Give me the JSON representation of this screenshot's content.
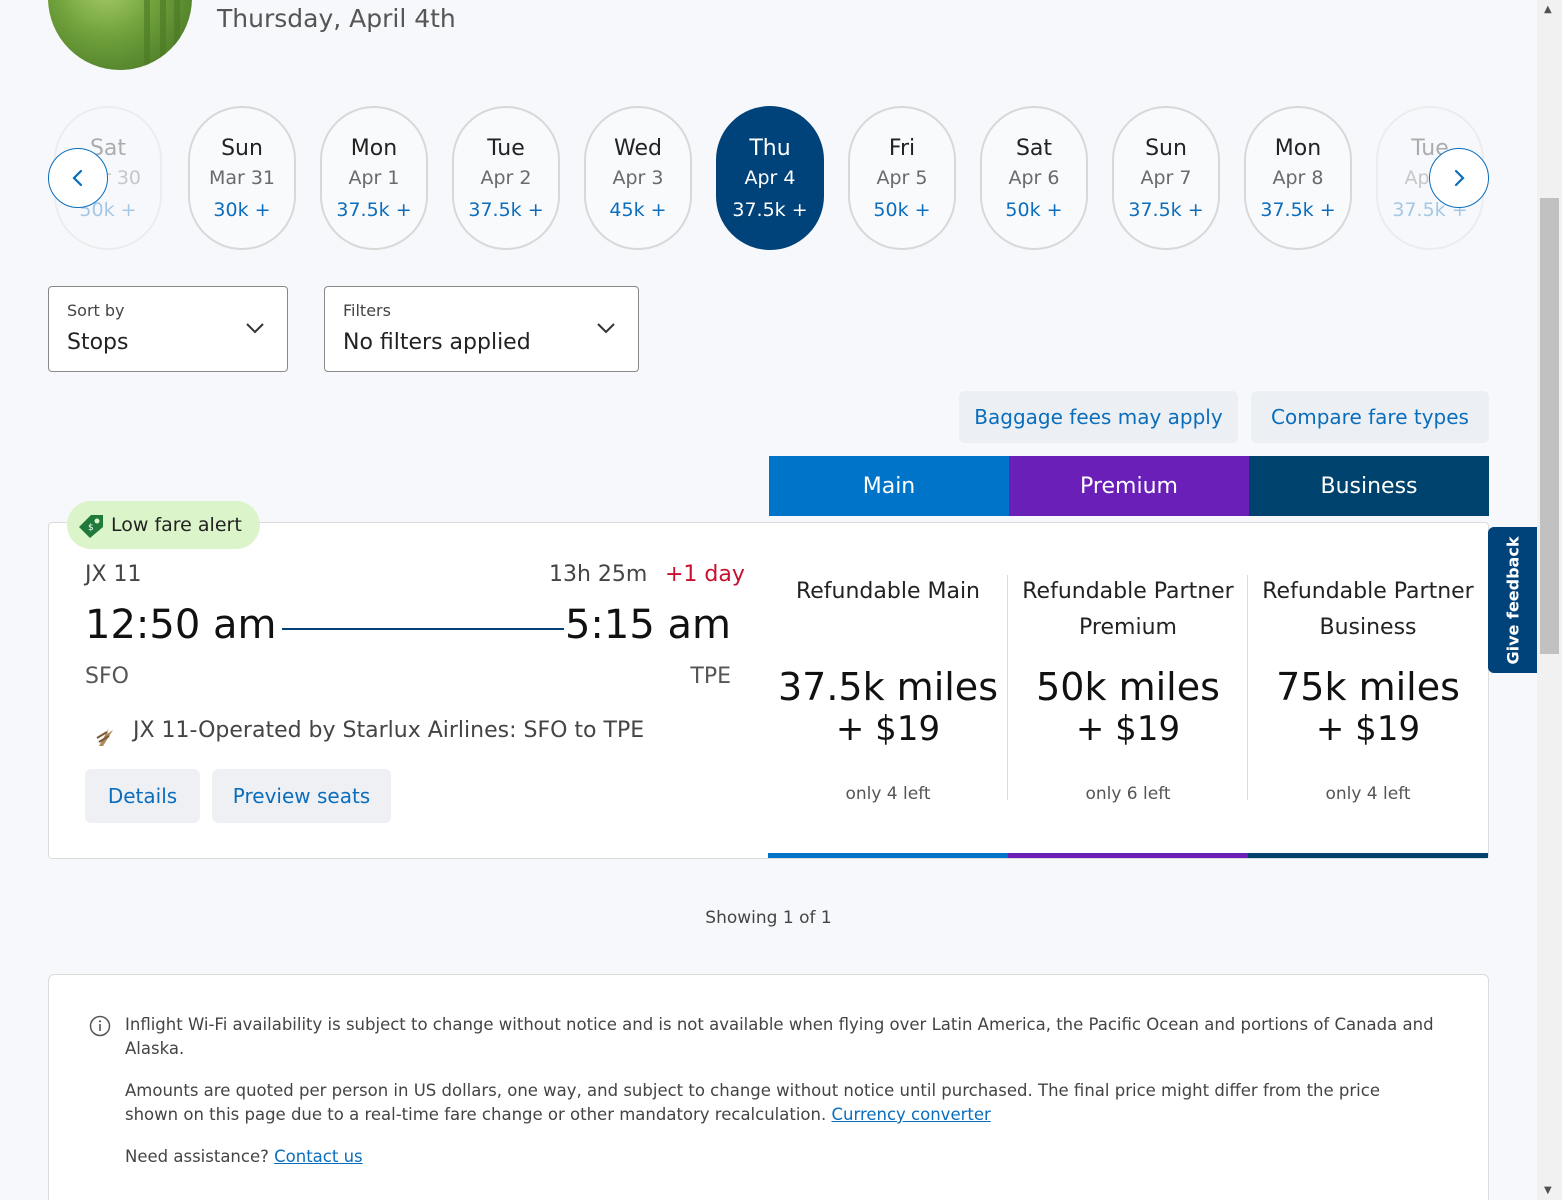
{
  "header": {
    "date": "Thursday, April 4th"
  },
  "date_strip": [
    {
      "dow": "Sat",
      "md": "Mar 30",
      "price": "50k +",
      "state": "faded"
    },
    {
      "dow": "Sun",
      "md": "Mar 31",
      "price": "30k +",
      "state": "normal"
    },
    {
      "dow": "Mon",
      "md": "Apr 1",
      "price": "37.5k +",
      "state": "normal"
    },
    {
      "dow": "Tue",
      "md": "Apr 2",
      "price": "37.5k +",
      "state": "normal"
    },
    {
      "dow": "Wed",
      "md": "Apr 3",
      "price": "45k +",
      "state": "normal"
    },
    {
      "dow": "Thu",
      "md": "Apr 4",
      "price": "37.5k +",
      "state": "selected"
    },
    {
      "dow": "Fri",
      "md": "Apr 5",
      "price": "50k +",
      "state": "normal"
    },
    {
      "dow": "Sat",
      "md": "Apr 6",
      "price": "50k +",
      "state": "normal"
    },
    {
      "dow": "Sun",
      "md": "Apr 7",
      "price": "37.5k +",
      "state": "normal"
    },
    {
      "dow": "Mon",
      "md": "Apr 8",
      "price": "37.5k +",
      "state": "normal"
    },
    {
      "dow": "Tue",
      "md": "Apr 9",
      "price": "37.5k +",
      "state": "faded"
    }
  ],
  "sort": {
    "label": "Sort by",
    "value": "Stops"
  },
  "filters": {
    "label": "Filters",
    "value": "No filters applied"
  },
  "links": {
    "baggage": "Baggage fees may apply",
    "compare": "Compare fare types"
  },
  "fare_tabs": [
    {
      "label": "Main",
      "color": "#0074c8"
    },
    {
      "label": "Premium",
      "color": "#6a1fb8"
    },
    {
      "label": "Business",
      "color": "#00426e"
    }
  ],
  "flight": {
    "badge": "Low fare alert",
    "number": "JX 11",
    "duration": "13h 25m",
    "plus_day": "+1 day",
    "depart_time": "12:50 am",
    "arrive_time": "5:15 am",
    "depart_airport": "SFO",
    "arrive_airport": "TPE",
    "operated_by": "JX 11-Operated by Starlux Airlines: SFO to TPE",
    "details_btn": "Details",
    "preview_btn": "Preview seats"
  },
  "fares": [
    {
      "name": "Refundable Main",
      "miles": "37.5k miles",
      "tax": "+ $19",
      "left": "only 4 left"
    },
    {
      "name": "Refundable Partner Premium",
      "miles": "50k miles",
      "tax": "+ $19",
      "left": "only 6 left"
    },
    {
      "name": "Refundable Partner Business",
      "miles": "75k miles",
      "tax": "+ $19",
      "left": "only 4 left"
    }
  ],
  "showing": "Showing 1 of 1",
  "notice": {
    "wifi": "Inflight Wi-Fi availability is subject to change without notice and is not available when flying over Latin America, the Pacific Ocean and portions of Canada and Alaska.",
    "amounts": "Amounts are quoted per person in US dollars, one way, and subject to change without notice until purchased. The final price might differ from the price shown on this page due to a real-time fare change or other mandatory recalculation.",
    "currency_link": "Currency converter",
    "assist": "Need assistance?",
    "contact_link": "Contact us"
  },
  "feedback": "Give feedback"
}
